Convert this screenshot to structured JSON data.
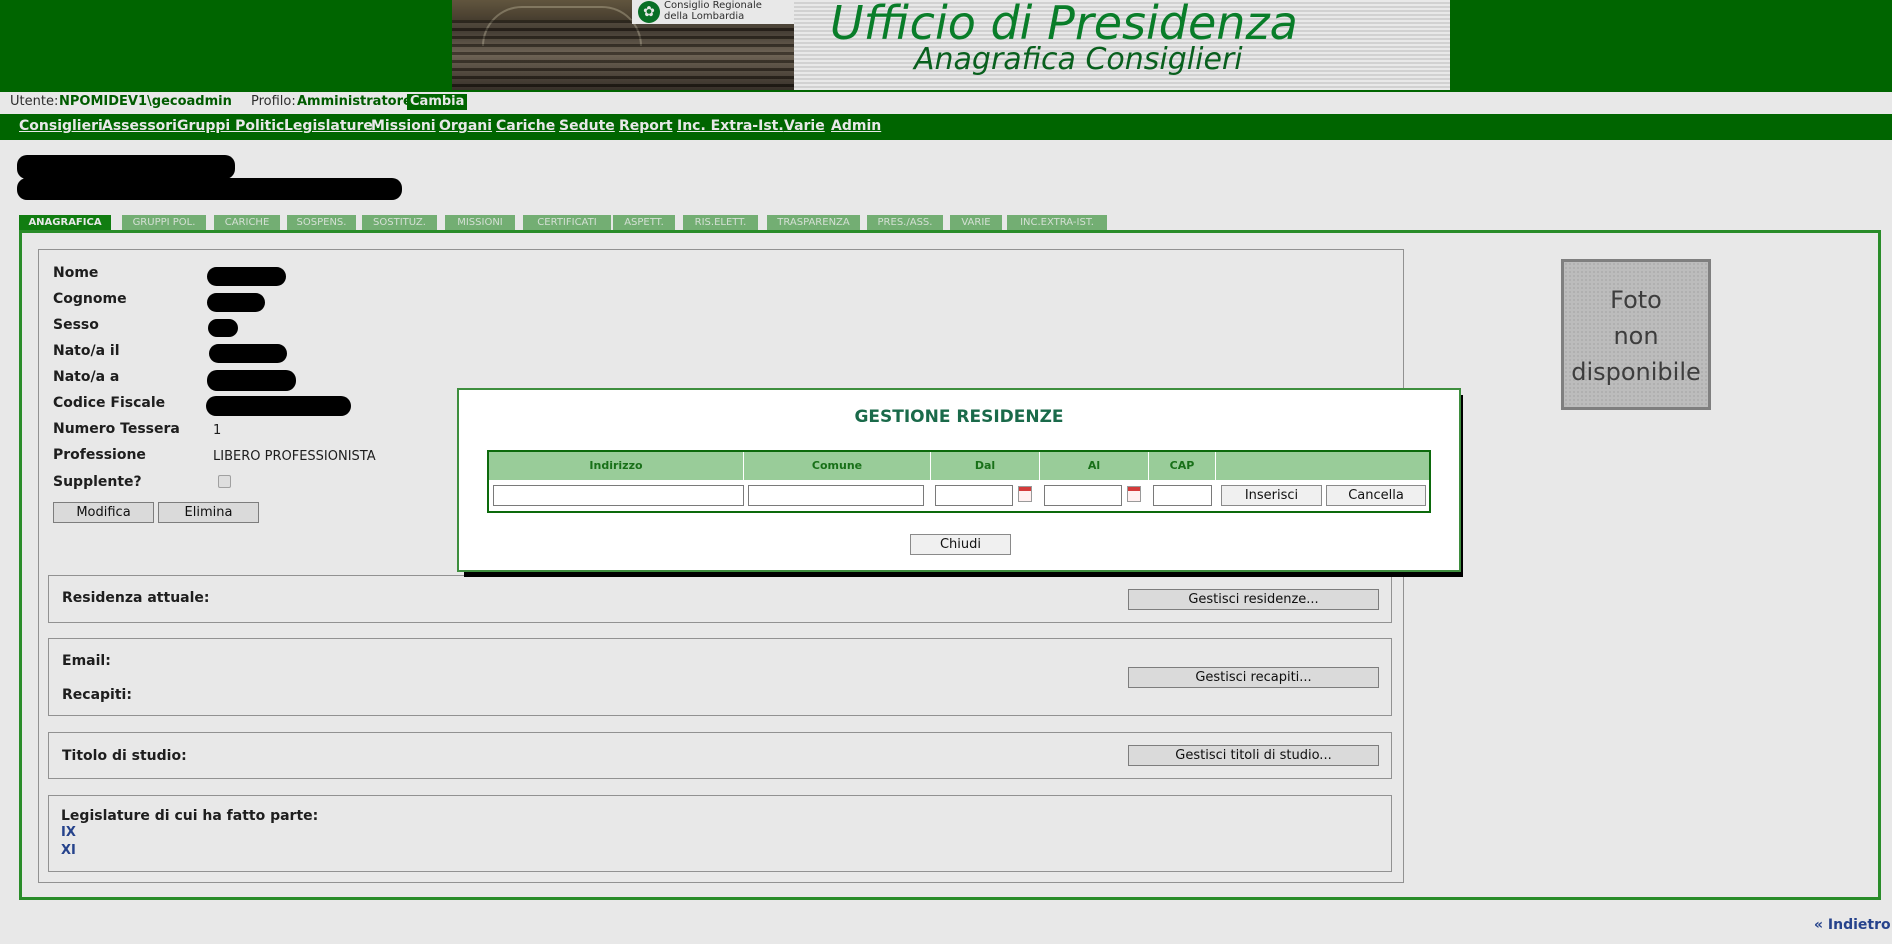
{
  "header": {
    "logo_text": "Consiglio Regionale\ndella Lombardia",
    "title": "Ufficio di Presidenza",
    "subtitle": "Anagrafica Consiglieri"
  },
  "userbar": {
    "user_label": "Utente:",
    "user_value": "NPOMIDEV1\\gecoadmin",
    "profile_label": "Profilo:",
    "profile_value": "Amministratore",
    "change_link": "Cambia"
  },
  "nav": {
    "items": [
      "Consiglieri",
      "Assessori",
      "Gruppi Politici",
      "Legislature",
      "Missioni",
      "Organi",
      "Cariche",
      "Sedute",
      "Report",
      "Inc. Extra-Ist.",
      "Varie",
      "Admin"
    ]
  },
  "tabs": [
    "ANAGRAFICA",
    "GRUPPI POL.",
    "CARICHE",
    "SOSPENS.",
    "SOSTITUZ.",
    "MISSIONI",
    "CERTIFICATI",
    "ASPETT.",
    "RIS.ELETT.",
    "TRASPARENZA",
    "PRES./ASS.",
    "VARIE",
    "INC.EXTRA-IST."
  ],
  "form": {
    "labels": {
      "nome": "Nome",
      "cognome": "Cognome",
      "sesso": "Sesso",
      "nato_il": "Nato/a il",
      "nato_a": "Nato/a a",
      "codice_fiscale": "Codice Fiscale",
      "numero_tessera": "Numero Tessera",
      "professione": "Professione",
      "supplente": "Supplente?"
    },
    "numero_tessera": "1",
    "professione": "LIBERO PROFESSIONISTA",
    "supplente_checked": false,
    "modifica_button": "Modifica",
    "elimina_button": "Elimina"
  },
  "sections": {
    "residenza_label": "Residenza attuale:",
    "residenza_button": "Gestisci residenze...",
    "email_label": "Email:",
    "recapiti_label": "Recapiti:",
    "recapiti_button": "Gestisci recapiti...",
    "titolo_label": "Titolo di studio:",
    "titolo_button": "Gestisci titoli di studio...",
    "legislature_label": "Legislature di cui ha fatto parte:",
    "legislature": [
      "IX",
      "XI"
    ]
  },
  "photo": {
    "text": "Foto\nnon\ndisponibile"
  },
  "back_link": "« Indietro",
  "dialog": {
    "title": "GESTIONE RESIDENZE",
    "headers": [
      "Indirizzo",
      "Comune",
      "Dal",
      "Al",
      "CAP",
      ""
    ],
    "inserisci_button": "Inserisci",
    "cancella_button": "Cancella",
    "chiudi_button": "Chiudi"
  },
  "colors": {
    "brand_green": "#007000",
    "tab_active": "#138a13",
    "tab_inactive": "#7fc07f",
    "link_blue": "#2a4a9a"
  }
}
